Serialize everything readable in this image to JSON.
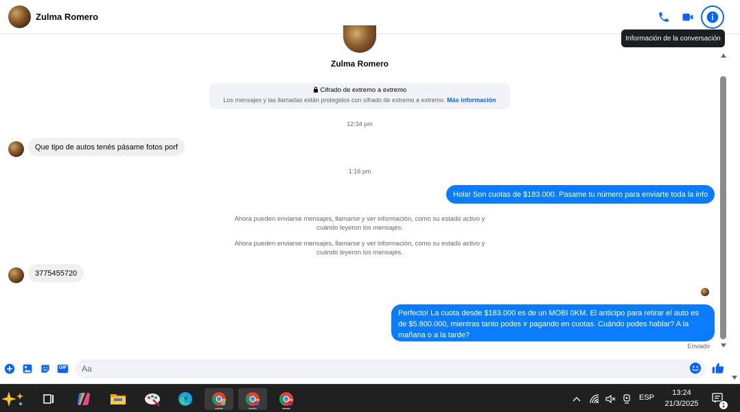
{
  "header": {
    "title": "Zulma Romero",
    "tooltip": "Información de la conversación"
  },
  "chat": {
    "profile_name": "Zulma Romero",
    "e2e": {
      "title": "Cifrado de extremo a extremo",
      "text": "Los mensajes y las llamadas están protegidos con cifrado de extremo a extremo.",
      "link": "Más información"
    },
    "timestamps": [
      "12:34 pm",
      "1:16 pm"
    ],
    "messages": [
      {
        "direction": "in",
        "text": "Que tipo de autos tenés pásame fotos porf"
      },
      {
        "direction": "out",
        "text": "Hola! Son cuotas de $183.000. Pasame tu número para enviarte toda la info"
      },
      {
        "direction": "in",
        "text": "3775455720"
      },
      {
        "direction": "out",
        "text": "Perfecto! La cuota desde $183.000 es de un MOBI 0KM. El anticipo para retirar el auto es de $5.800.000, mientras tanto podes ir pagando en cuotas. Cuándo podes hablar? A la mañana o a la tarde?"
      }
    ],
    "system_notes": [
      "Ahora pueden enviarse mensajes, llamarse y ver información, como su estado activo y cuándo leyeron los mensajes.",
      "Ahora pueden enviarse mensajes, llamarse y ver información, como su estado activo y cuándo leyeron los mensajes."
    ],
    "status": "Enviado"
  },
  "composer": {
    "placeholder": "Aa",
    "gif_label": "GIF"
  },
  "taskbar": {
    "language": "ESP",
    "time": "13:24",
    "date": "21/3/2025",
    "notification_count": "1"
  },
  "colors": {
    "accent": "#0866ff",
    "outgoing_bubble": "#0a7cff",
    "incoming_bubble": "#f0f0f0",
    "taskbar": "#202020"
  }
}
